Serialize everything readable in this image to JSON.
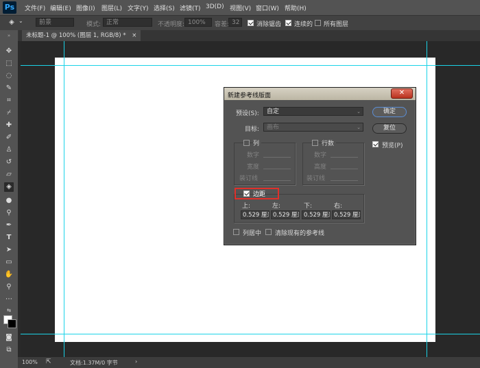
{
  "app": {
    "logo": "Ps"
  },
  "menu": [
    "文件(F)",
    "编辑(E)",
    "图像(I)",
    "图层(L)",
    "文字(Y)",
    "选择(S)",
    "滤镜(T)",
    "3D(D)",
    "视图(V)",
    "窗口(W)",
    "帮助(H)"
  ],
  "options": {
    "fill_source": "前景",
    "mode_label": "模式:",
    "mode_value": "正常",
    "opacity_label": "不透明度:",
    "opacity_value": "100%",
    "tolerance_label": "容差:",
    "tolerance_value": "32",
    "antialias_label": "消除锯齿",
    "contiguous_label": "连续的",
    "all_layers_label": "所有图层"
  },
  "document": {
    "tab_title": "未标题-1 @ 100% (图层 1, RGB/8) *",
    "close": "×"
  },
  "status": {
    "zoom": "100%",
    "doc_info": "文档:1.37M/0 字节"
  },
  "dialog": {
    "title": "新建参考线版面",
    "close": "✕",
    "preset_label": "预设(S):",
    "preset_value": "自定",
    "target_label": "目标:",
    "target_value": "画布",
    "columns": {
      "label": "列",
      "number": "数字",
      "width": "宽度",
      "gutter": "装订线"
    },
    "rows": {
      "label": "行数",
      "number": "数字",
      "height": "高度",
      "gutter": "装订线"
    },
    "margin": {
      "label": "边距",
      "top_label": "上:",
      "left_label": "左:",
      "bottom_label": "下:",
      "right_label": "右:",
      "top": "0.529 厘米",
      "left": "0.529 厘米",
      "bottom": "0.529 厘米",
      "right": "0.529 厘米"
    },
    "center_columns_label": "列居中",
    "clear_guides_label": "清除现有的参考线",
    "ok_label": "确定",
    "reset_label": "复位",
    "preview_label": "预览(P)"
  },
  "colors": {
    "guide": "#1ad3e8",
    "highlight": "#e0302a",
    "default_button": "#5b8ed6"
  }
}
